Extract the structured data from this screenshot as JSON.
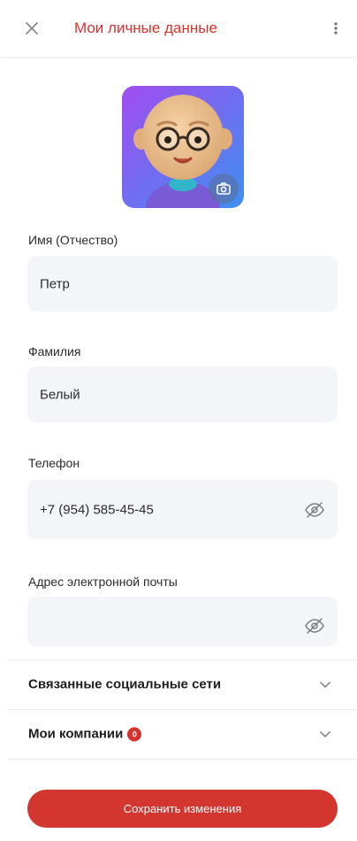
{
  "header": {
    "title": "Мои личные данные",
    "close_icon": "close-icon",
    "menu_icon": "kebab-icon",
    "accent_color": "#d8322c"
  },
  "avatar": {
    "camera_icon": "camera-icon"
  },
  "fields": [
    {
      "label": "Имя (Отчество)",
      "value": "Петр"
    },
    {
      "label": "Фамилия",
      "value": "Белый"
    },
    {
      "label": "Телефон",
      "value": "+7 (954) 585-45-45",
      "visibility_icon": "eye-off-icon"
    },
    {
      "label": "Адрес электронной почты",
      "value": "",
      "visibility_icon": "eye-off-icon"
    }
  ],
  "sections": [
    {
      "title": "Связанные социальные сети",
      "icon": "chevron-down-icon"
    },
    {
      "title": "Мои компании",
      "badge": "0",
      "icon": "chevron-down-icon"
    }
  ],
  "actions": {
    "save_label": "Сохранить изменения",
    "save_color": "#d3352f"
  }
}
